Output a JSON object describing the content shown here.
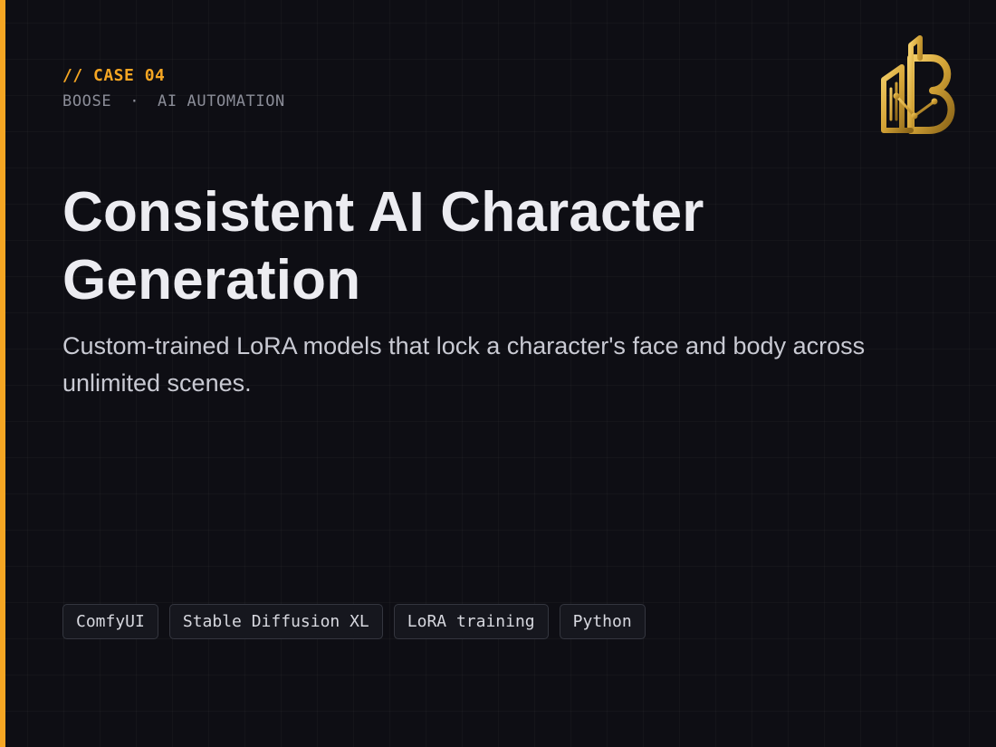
{
  "case": {
    "eyebrow": "// CASE 04",
    "company": "BOOSE",
    "separator": "·",
    "category": "AI AUTOMATION"
  },
  "hero": {
    "title": "Consistent AI Character Generation",
    "subtitle": "Custom-trained LoRA models that lock a character's face and body across unlimited scenes."
  },
  "tags": [
    "ComfyUI",
    "Stable Diffusion XL",
    "LoRA training",
    "Python"
  ],
  "brand": {
    "logo_icon": "building-b-logo-icon",
    "accent_color": "#f5a623",
    "logo_gold": "#d4a437",
    "background": "#0e0e14"
  }
}
